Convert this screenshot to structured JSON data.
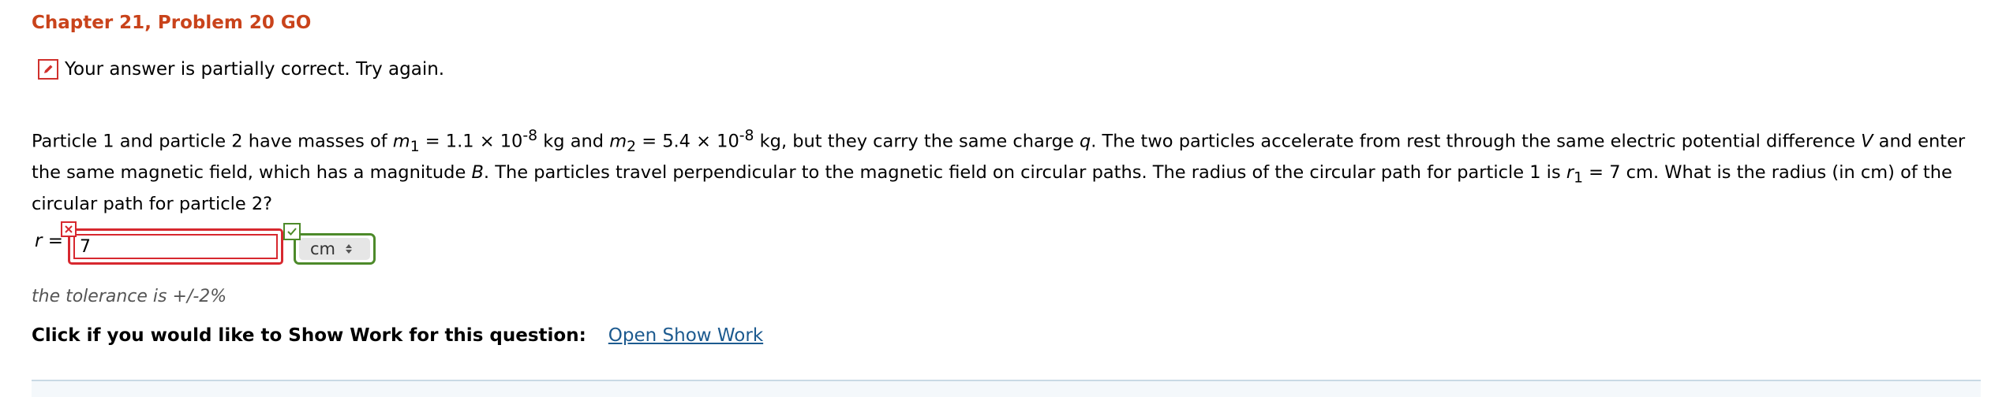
{
  "header": {
    "title": "Chapter 21, Problem 20 GO"
  },
  "feedback": {
    "icon": "edit-icon",
    "text": "Your answer is partially correct.  Try again."
  },
  "question": {
    "t1": "Particle 1 and particle 2 have masses of ",
    "m1_sym": "m",
    "m1_sub": "1",
    "t2": " = 1.1 × 10",
    "exp1": "-8",
    "t3": " kg and ",
    "m2_sym": "m",
    "m2_sub": "2",
    "t4": " = 5.4 × 10",
    "exp2": "-8",
    "t5": " kg, but they carry the same charge ",
    "q_sym": "q",
    "t6": ". The two particles accelerate from rest through the same electric potential difference ",
    "v_sym": "V",
    "t7": " and enter the same magnetic field, which has a magnitude ",
    "b_sym": "B",
    "t8": ". The particles travel perpendicular to the magnetic field on circular paths. The radius of the circular path for particle 1 is ",
    "r1_sym": "r",
    "r1_sub": "1",
    "t9": " = 7 cm. What is the radius (in cm) of the circular path for particle 2?"
  },
  "answer": {
    "var": "r",
    "eq": " =",
    "value": "7",
    "status": "incorrect",
    "unit": "cm",
    "unit_status": "correct"
  },
  "colors": {
    "title": "#c9431b",
    "incorrect": "#d7282f",
    "correct": "#4d8a2a",
    "link": "#1c5a8f"
  },
  "tolerance": "the tolerance is +/-2%",
  "showwork": {
    "label": "Click if you would like to Show Work for this question:",
    "link": "Open Show Work"
  }
}
